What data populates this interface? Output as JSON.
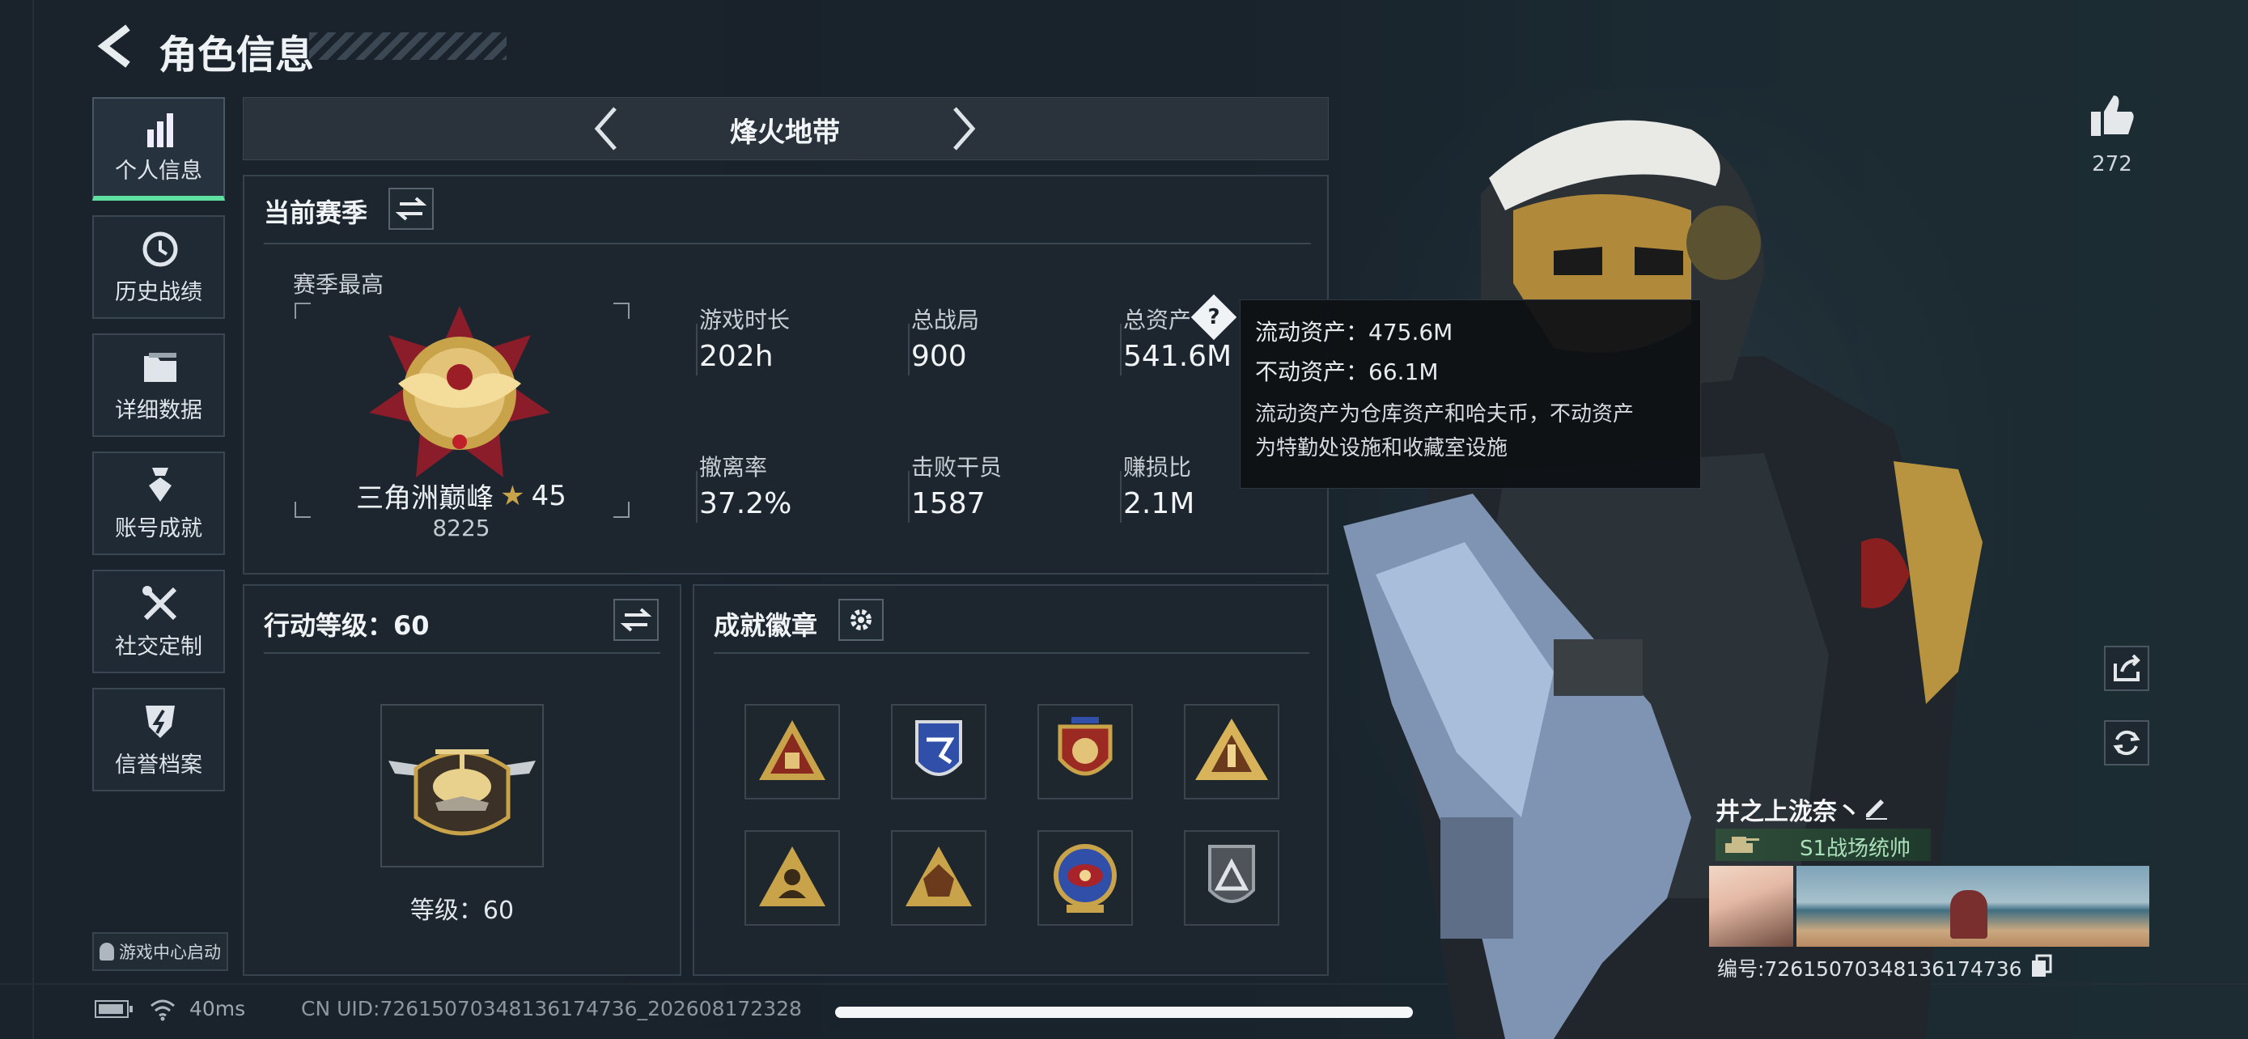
{
  "header": {
    "title": "角色信息"
  },
  "sidebar": {
    "items": [
      {
        "label": "个人信息",
        "icon": "bar-chart-icon",
        "active": true
      },
      {
        "label": "历史战绩",
        "icon": "clock-history-icon",
        "active": false
      },
      {
        "label": "详细数据",
        "icon": "folder-icon",
        "active": false
      },
      {
        "label": "账号成就",
        "icon": "medal-icon",
        "active": false
      },
      {
        "label": "社交定制",
        "icon": "tools-icon",
        "active": false
      },
      {
        "label": "信誉档案",
        "icon": "shield-lightning-icon",
        "active": false
      }
    ],
    "launch_label": "游戏中心启动"
  },
  "mode_switcher": {
    "label": "烽火地带"
  },
  "season": {
    "title": "当前赛季",
    "best_label": "赛季最高",
    "rank_name": "三角洲巅峰",
    "rank_stars": "45",
    "rank_points": "8225",
    "stats": [
      {
        "label": "游戏时长",
        "value": "202h"
      },
      {
        "label": "总战局",
        "value": "900"
      },
      {
        "label": "总资产",
        "value": "541.6M"
      },
      {
        "label": "撤离率",
        "value": "37.2%"
      },
      {
        "label": "击败干员",
        "value": "1587"
      },
      {
        "label": "赚损比",
        "value": "2.1M"
      }
    ]
  },
  "tooltip": {
    "liquid": "流动资产：475.6M",
    "fixed": "不动资产：66.1M",
    "desc_line1": "流动资产为仓库资产和哈夫币，不动资产",
    "desc_line2": "为特勤处设施和收藏室设施"
  },
  "action_level": {
    "title": "行动等级：60",
    "level_text": "等级：60"
  },
  "achievements": {
    "title": "成就徽章"
  },
  "likes": {
    "count": "272"
  },
  "profile": {
    "name": "井之上泷奈丶",
    "title_badge": "S1战场统帅",
    "id_text": "编号:72615070348136174736"
  },
  "status_bar": {
    "ping": "40ms",
    "uid": "CN UID:72615070348136174736_202608172328"
  },
  "colors": {
    "accent": "#5fe0a0",
    "tooltip_bg": "#0e1114",
    "panel_bg": "#1d262f",
    "gold": "#c9a34a"
  }
}
